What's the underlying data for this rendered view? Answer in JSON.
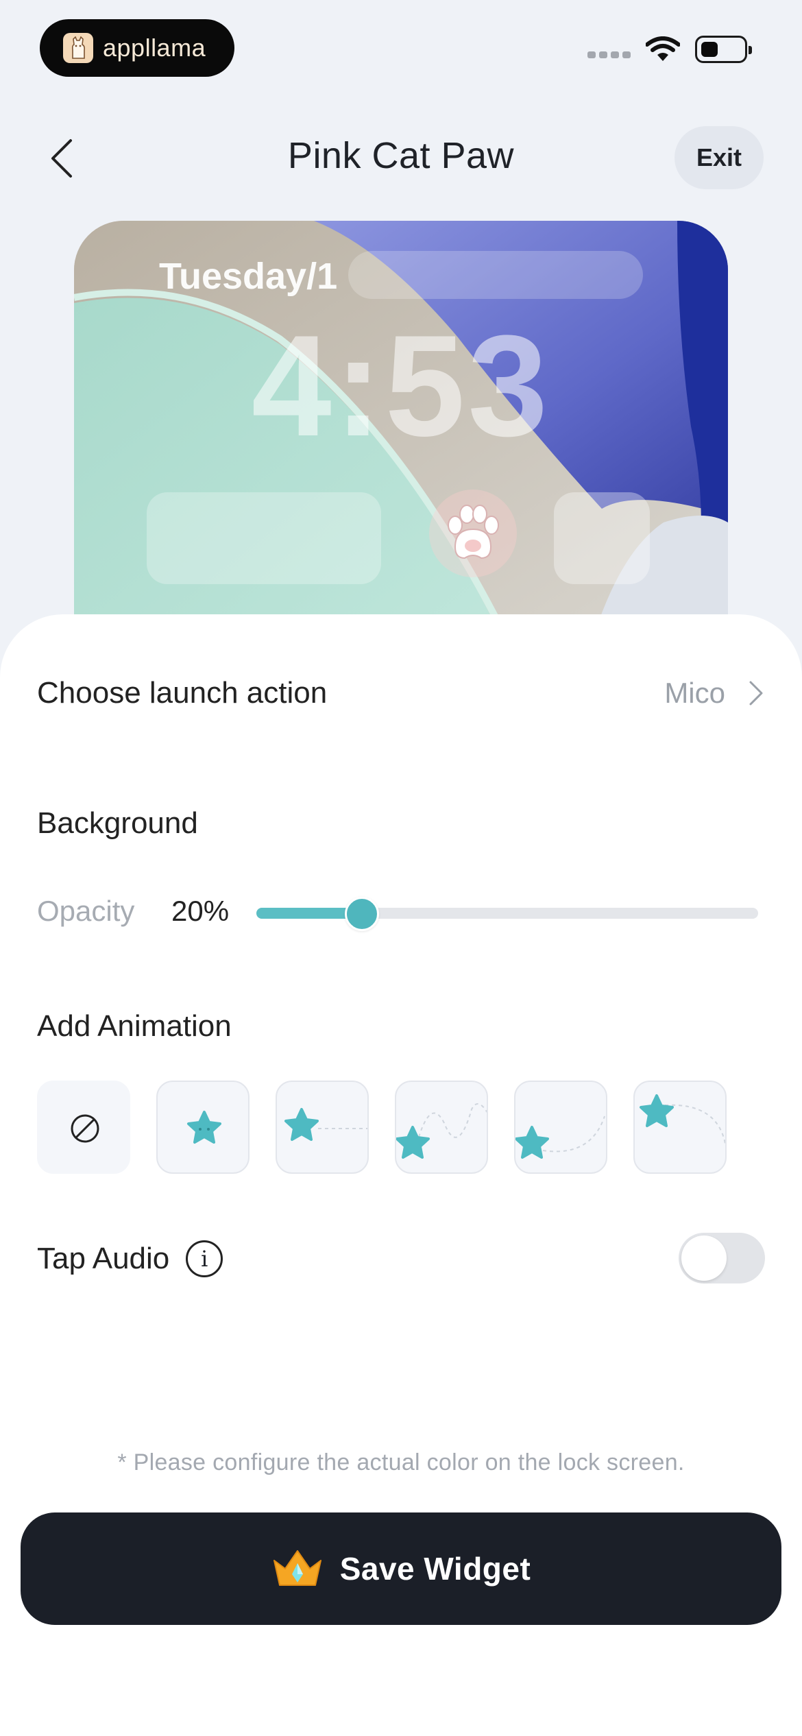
{
  "status_bar": {
    "app_badge": "appllama"
  },
  "header": {
    "title": "Pink Cat Paw",
    "exit_label": "Exit"
  },
  "preview": {
    "date": "Tuesday/1",
    "time": "4:53"
  },
  "launch_action": {
    "label": "Choose launch action",
    "value": "Mico"
  },
  "background": {
    "title": "Background",
    "opacity_label": "Opacity",
    "opacity_value": "20%",
    "opacity_fraction": 0.2
  },
  "animation": {
    "title": "Add Animation",
    "options": [
      "none",
      "star-bounce",
      "star-slide",
      "star-wave",
      "star-arc",
      "star-drop"
    ]
  },
  "tap_audio": {
    "label": "Tap Audio",
    "enabled": false
  },
  "note": "* Please configure the actual color on the lock screen.",
  "save": {
    "label": "Save Widget"
  },
  "colors": {
    "accent": "#4fb6bd",
    "dark": "#1b1f28",
    "star": "#4ebac2"
  }
}
